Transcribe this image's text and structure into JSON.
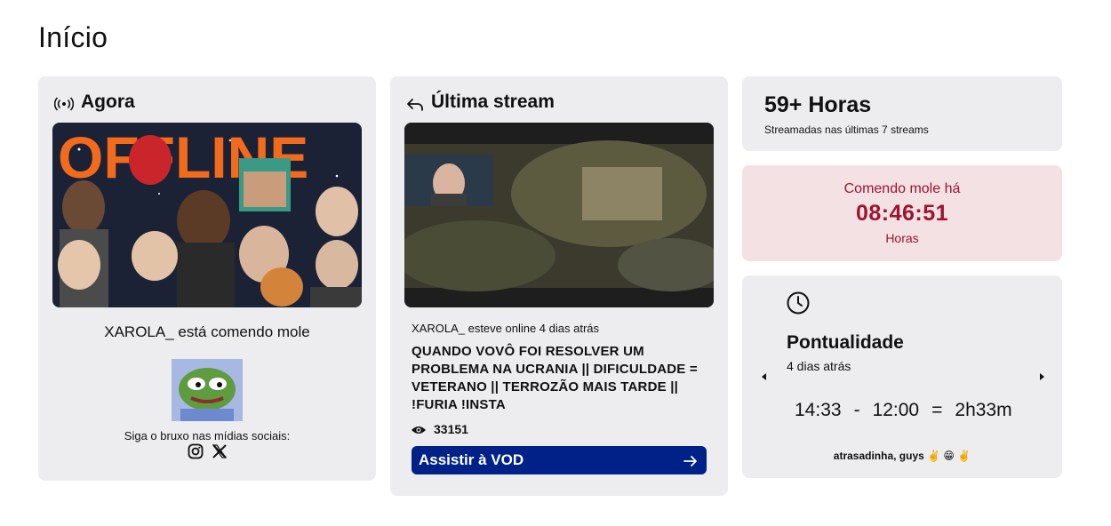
{
  "page": {
    "title": "Início"
  },
  "now_card": {
    "heading": "Agora",
    "heading_icon": "broadcast-icon",
    "status_text": "XAROLA_ está comendo mole",
    "follow_text": "Siga o bruxo nas mídias sociais:",
    "social_icons": [
      "instagram-icon",
      "x-icon"
    ]
  },
  "last_stream_card": {
    "heading": "Última stream",
    "heading_icon": "back-arrow-icon",
    "online_text": "XAROLA_ esteve online 4 dias atrás",
    "vod_title": "QUANDO VOVÔ FOI RESOLVER UM PROBLEMA NA UCRANIA || DIFICULDADE = VETERANO || TERROZÃO MAIS TARDE || !FURIA !INSTA",
    "views": "33151",
    "button_label": "Assistir à VOD",
    "button_color": "#002288"
  },
  "hours_card": {
    "value": "59+ Horas",
    "subtitle": "Streamadas nas últimas 7 streams"
  },
  "eating_card": {
    "label": "Comendo mole há",
    "time": "08:46:51",
    "unit": "Horas",
    "accent_color": "#9b1530",
    "background": "#f4e1e4"
  },
  "punctuality_card": {
    "title": "Pontualidade",
    "ago": "4 dias atrás",
    "start_time": "14:33",
    "minus": "-",
    "scheduled_time": "12:00",
    "equals": "=",
    "delay": "2h33m",
    "note": "atrasadinha, guys ✌️ 😁 ✌️"
  }
}
